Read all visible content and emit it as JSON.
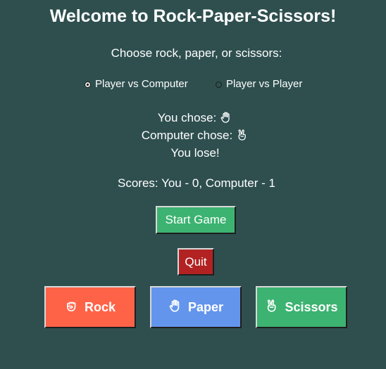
{
  "title": "Welcome to Rock-Paper-Scissors!",
  "prompt": "Choose rock, paper, or scissors:",
  "modes": [
    {
      "label": "Player vs Computer",
      "selected": true
    },
    {
      "label": "Player vs Player",
      "selected": false
    }
  ],
  "result": {
    "you_chose_label": "You chose:",
    "you_chose_icon": "paper-hand-icon",
    "computer_chose_label": "Computer chose:",
    "computer_chose_icon": "scissors-hand-icon",
    "outcome": "You lose!"
  },
  "scores": "Scores: You - 0, Computer - 1",
  "buttons": {
    "start": "Start Game",
    "quit": "Quit",
    "rock": "Rock",
    "paper": "Paper",
    "scissors": "Scissors"
  },
  "colors": {
    "background": "#2f4f4f",
    "start": "#3cb371",
    "quit": "#b22222",
    "rock": "#ff6347",
    "paper": "#6495ed",
    "scissors": "#3cb371"
  }
}
